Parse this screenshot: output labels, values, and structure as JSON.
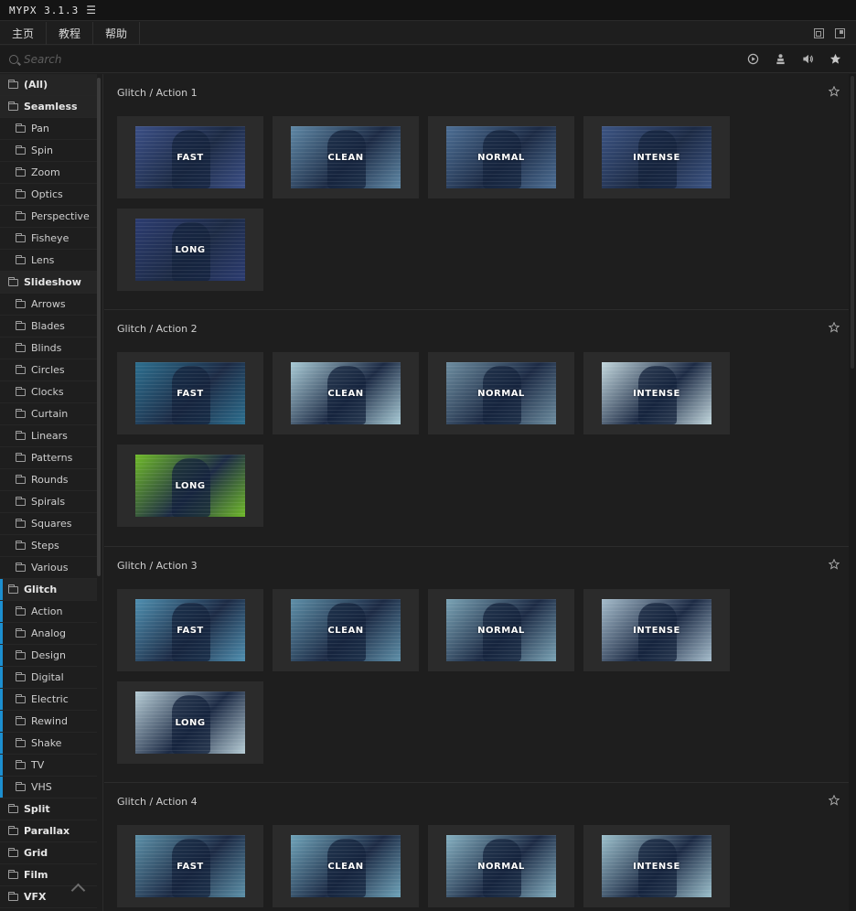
{
  "app": {
    "title": "MYPX 3.1.3"
  },
  "menu": {
    "tabs": [
      "主页",
      "教程",
      "帮助"
    ]
  },
  "search": {
    "placeholder": "Search"
  },
  "sidebar": {
    "items": [
      {
        "label": "(All)",
        "type": "category"
      },
      {
        "label": "Seamless",
        "type": "category"
      },
      {
        "label": "Pan",
        "type": "sub"
      },
      {
        "label": "Spin",
        "type": "sub"
      },
      {
        "label": "Zoom",
        "type": "sub"
      },
      {
        "label": "Optics",
        "type": "sub"
      },
      {
        "label": "Perspective",
        "type": "sub"
      },
      {
        "label": "Fisheye",
        "type": "sub"
      },
      {
        "label": "Lens",
        "type": "sub"
      },
      {
        "label": "Slideshow",
        "type": "category"
      },
      {
        "label": "Arrows",
        "type": "sub"
      },
      {
        "label": "Blades",
        "type": "sub"
      },
      {
        "label": "Blinds",
        "type": "sub"
      },
      {
        "label": "Circles",
        "type": "sub"
      },
      {
        "label": "Clocks",
        "type": "sub"
      },
      {
        "label": "Curtain",
        "type": "sub"
      },
      {
        "label": "Linears",
        "type": "sub"
      },
      {
        "label": "Patterns",
        "type": "sub"
      },
      {
        "label": "Rounds",
        "type": "sub"
      },
      {
        "label": "Spirals",
        "type": "sub"
      },
      {
        "label": "Squares",
        "type": "sub"
      },
      {
        "label": "Steps",
        "type": "sub"
      },
      {
        "label": "Various",
        "type": "sub"
      },
      {
        "label": "Glitch",
        "type": "category",
        "selected": true
      },
      {
        "label": "Action",
        "type": "sub",
        "group": "glitch"
      },
      {
        "label": "Analog",
        "type": "sub",
        "group": "glitch"
      },
      {
        "label": "Design",
        "type": "sub",
        "group": "glitch"
      },
      {
        "label": "Digital",
        "type": "sub",
        "group": "glitch"
      },
      {
        "label": "Electric",
        "type": "sub",
        "group": "glitch"
      },
      {
        "label": "Rewind",
        "type": "sub",
        "group": "glitch"
      },
      {
        "label": "Shake",
        "type": "sub",
        "group": "glitch"
      },
      {
        "label": "TV",
        "type": "sub",
        "group": "glitch"
      },
      {
        "label": "VHS",
        "type": "sub",
        "group": "glitch"
      },
      {
        "label": "Split",
        "type": "category-plain"
      },
      {
        "label": "Parallax",
        "type": "category-plain"
      },
      {
        "label": "Grid",
        "type": "category-plain"
      },
      {
        "label": "Film",
        "type": "category-plain"
      },
      {
        "label": "VFX",
        "type": "category-plain"
      }
    ]
  },
  "sections": [
    {
      "title": "Glitch / Action 1",
      "presets": [
        "FAST",
        "CLEAN",
        "NORMAL",
        "INTENSE",
        "LONG"
      ],
      "tints": [
        "#3b4f86",
        "#5f88a6",
        "#4d6f95",
        "#3c5483",
        "#2c3c70"
      ]
    },
    {
      "title": "Glitch / Action 2",
      "presets": [
        "FAST",
        "CLEAN",
        "NORMAL",
        "INTENSE",
        "LONG"
      ],
      "tints": [
        "#2d6f8f",
        "#a9cbd6",
        "#6d8da0",
        "#c3d8de",
        "#6fb92a"
      ]
    },
    {
      "title": "Glitch / Action 3",
      "presets": [
        "FAST",
        "CLEAN",
        "NORMAL",
        "INTENSE",
        "LONG"
      ],
      "tints": [
        "#4f8fb0",
        "#5e8fa8",
        "#7aa3b5",
        "#a5bccb",
        "#b7cdd6"
      ]
    },
    {
      "title": "Glitch / Action 4",
      "presets": [
        "FAST",
        "CLEAN",
        "NORMAL",
        "INTENSE"
      ],
      "tints": [
        "#5c90a8",
        "#6fa3b9",
        "#85b0c1",
        "#9cc0cc"
      ]
    }
  ],
  "icons": {
    "title_menu": "hamburger-icon",
    "tools": [
      "play-icon",
      "user-icon",
      "volume-icon",
      "star-icon"
    ],
    "window": [
      "restore-icon",
      "popout-icon"
    ]
  }
}
